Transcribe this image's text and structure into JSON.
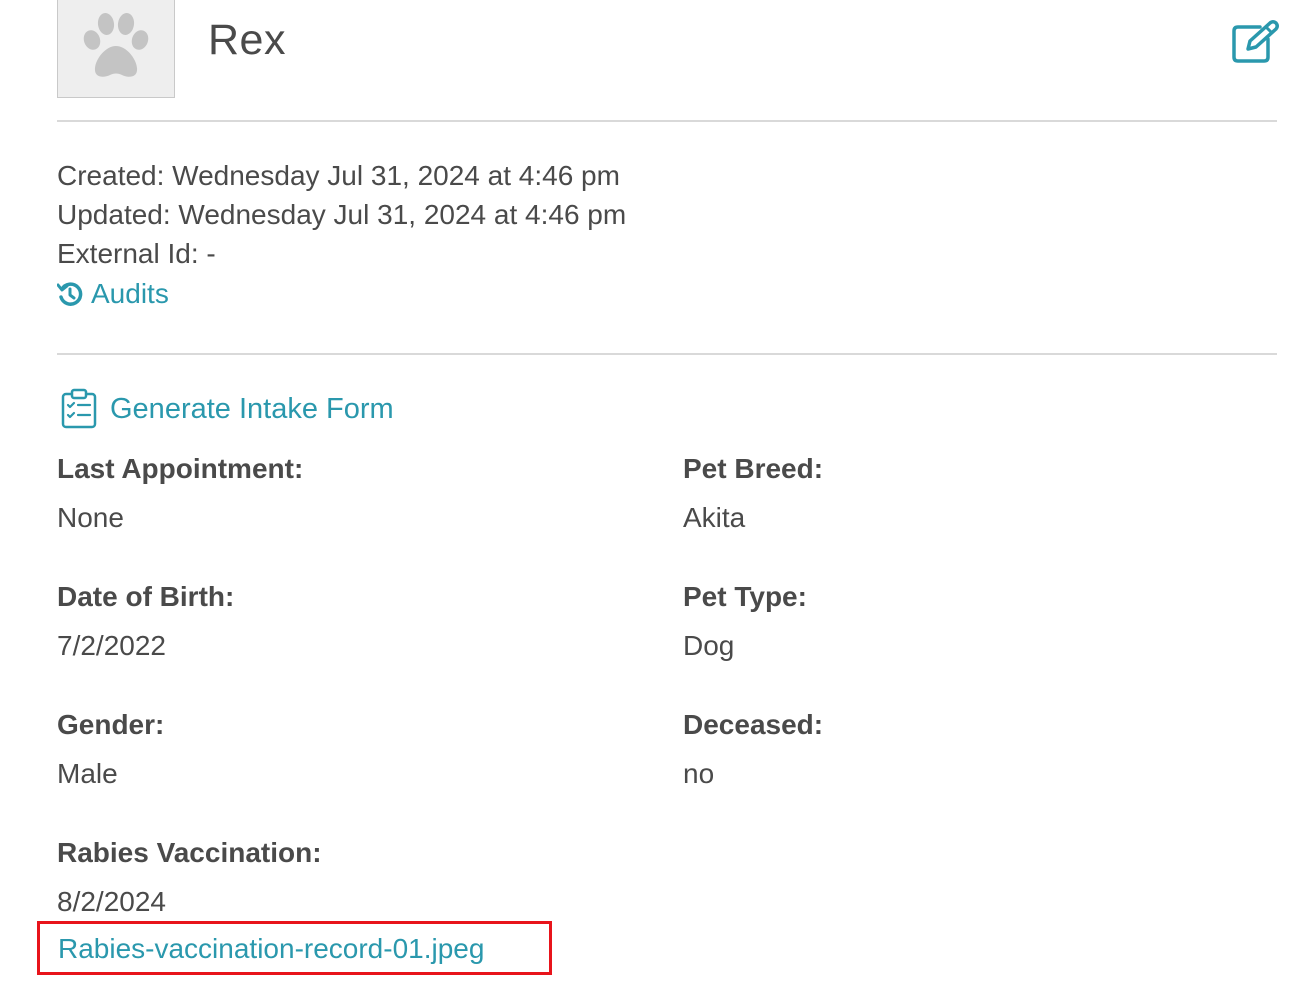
{
  "pet": {
    "name": "Rex",
    "avatar_icon": "paw-icon",
    "edit_icon": "edit-icon"
  },
  "meta": {
    "created": "Created: Wednesday Jul 31, 2024 at 4:46 pm",
    "updated": "Updated: Wednesday Jul 31, 2024 at 4:46 pm",
    "external_id": "External Id: -",
    "audits_label": "Audits",
    "audits_icon": "history-icon"
  },
  "intake": {
    "label": "Generate Intake Form",
    "icon": "clipboard-check-icon"
  },
  "fields": {
    "last_appointment": {
      "label": "Last Appointment:",
      "value": "None"
    },
    "pet_breed": {
      "label": "Pet Breed:",
      "value": "Akita"
    },
    "date_of_birth": {
      "label": "Date of Birth:",
      "value": "7/2/2022"
    },
    "pet_type": {
      "label": "Pet Type:",
      "value": "Dog"
    },
    "gender": {
      "label": "Gender:",
      "value": "Male"
    },
    "deceased": {
      "label": "Deceased:",
      "value": "no"
    },
    "rabies_vaccination": {
      "label": "Rabies Vaccination:",
      "value": "8/2/2024",
      "attachment": "Rabies-vaccination-record-01.jpeg"
    }
  },
  "colors": {
    "link": "#2a98ad",
    "text": "#4a4a4a",
    "divider": "#d9d9d9",
    "highlight_border": "#e8141b",
    "avatar_bg": "#eeeeee"
  }
}
